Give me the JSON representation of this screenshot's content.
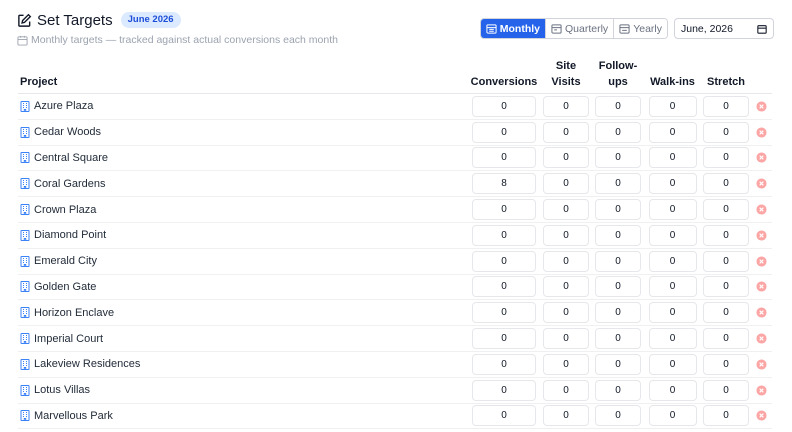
{
  "header": {
    "title": "Set Targets",
    "period_badge": "June 2026",
    "subtitle": "Monthly targets — tracked against actual conversions each month"
  },
  "period_tabs": [
    {
      "label": "Monthly",
      "icon": "calendar-icon",
      "active": true
    },
    {
      "label": "Quarterly",
      "icon": "calendar-range-icon",
      "active": false
    },
    {
      "label": "Yearly",
      "icon": "calendar-year-icon",
      "active": false
    }
  ],
  "date_picker": {
    "value": "June, 2026",
    "icon": "calendar-icon"
  },
  "table": {
    "headers": {
      "project": "Project",
      "conversions": "Conversions",
      "site_visits": "Site Visits",
      "follow_ups": "Follow-ups",
      "walk_ins": "Walk-ins",
      "stretch": "Stretch"
    },
    "rows": [
      {
        "project": "Azure Plaza",
        "conversions": "0",
        "site_visits": "0",
        "follow_ups": "0",
        "walk_ins": "0",
        "stretch": "0"
      },
      {
        "project": "Cedar Woods",
        "conversions": "0",
        "site_visits": "0",
        "follow_ups": "0",
        "walk_ins": "0",
        "stretch": "0"
      },
      {
        "project": "Central Square",
        "conversions": "0",
        "site_visits": "0",
        "follow_ups": "0",
        "walk_ins": "0",
        "stretch": "0"
      },
      {
        "project": "Coral Gardens",
        "conversions": "8",
        "site_visits": "0",
        "follow_ups": "0",
        "walk_ins": "0",
        "stretch": "0"
      },
      {
        "project": "Crown Plaza",
        "conversions": "0",
        "site_visits": "0",
        "follow_ups": "0",
        "walk_ins": "0",
        "stretch": "0"
      },
      {
        "project": "Diamond Point",
        "conversions": "0",
        "site_visits": "0",
        "follow_ups": "0",
        "walk_ins": "0",
        "stretch": "0"
      },
      {
        "project": "Emerald City",
        "conversions": "0",
        "site_visits": "0",
        "follow_ups": "0",
        "walk_ins": "0",
        "stretch": "0"
      },
      {
        "project": "Golden Gate",
        "conversions": "0",
        "site_visits": "0",
        "follow_ups": "0",
        "walk_ins": "0",
        "stretch": "0"
      },
      {
        "project": "Horizon Enclave",
        "conversions": "0",
        "site_visits": "0",
        "follow_ups": "0",
        "walk_ins": "0",
        "stretch": "0"
      },
      {
        "project": "Imperial Court",
        "conversions": "0",
        "site_visits": "0",
        "follow_ups": "0",
        "walk_ins": "0",
        "stretch": "0"
      },
      {
        "project": "Lakeview Residences",
        "conversions": "0",
        "site_visits": "0",
        "follow_ups": "0",
        "walk_ins": "0",
        "stretch": "0"
      },
      {
        "project": "Lotus Villas",
        "conversions": "0",
        "site_visits": "0",
        "follow_ups": "0",
        "walk_ins": "0",
        "stretch": "0"
      },
      {
        "project": "Marvellous Park",
        "conversions": "0",
        "site_visits": "0",
        "follow_ups": "0",
        "walk_ins": "0",
        "stretch": "0"
      }
    ]
  },
  "colors": {
    "accent": "#2563eb",
    "badge_bg": "#dbeafe",
    "project_icon": "#3b82f6",
    "delete_icon": "#fca5a5"
  }
}
